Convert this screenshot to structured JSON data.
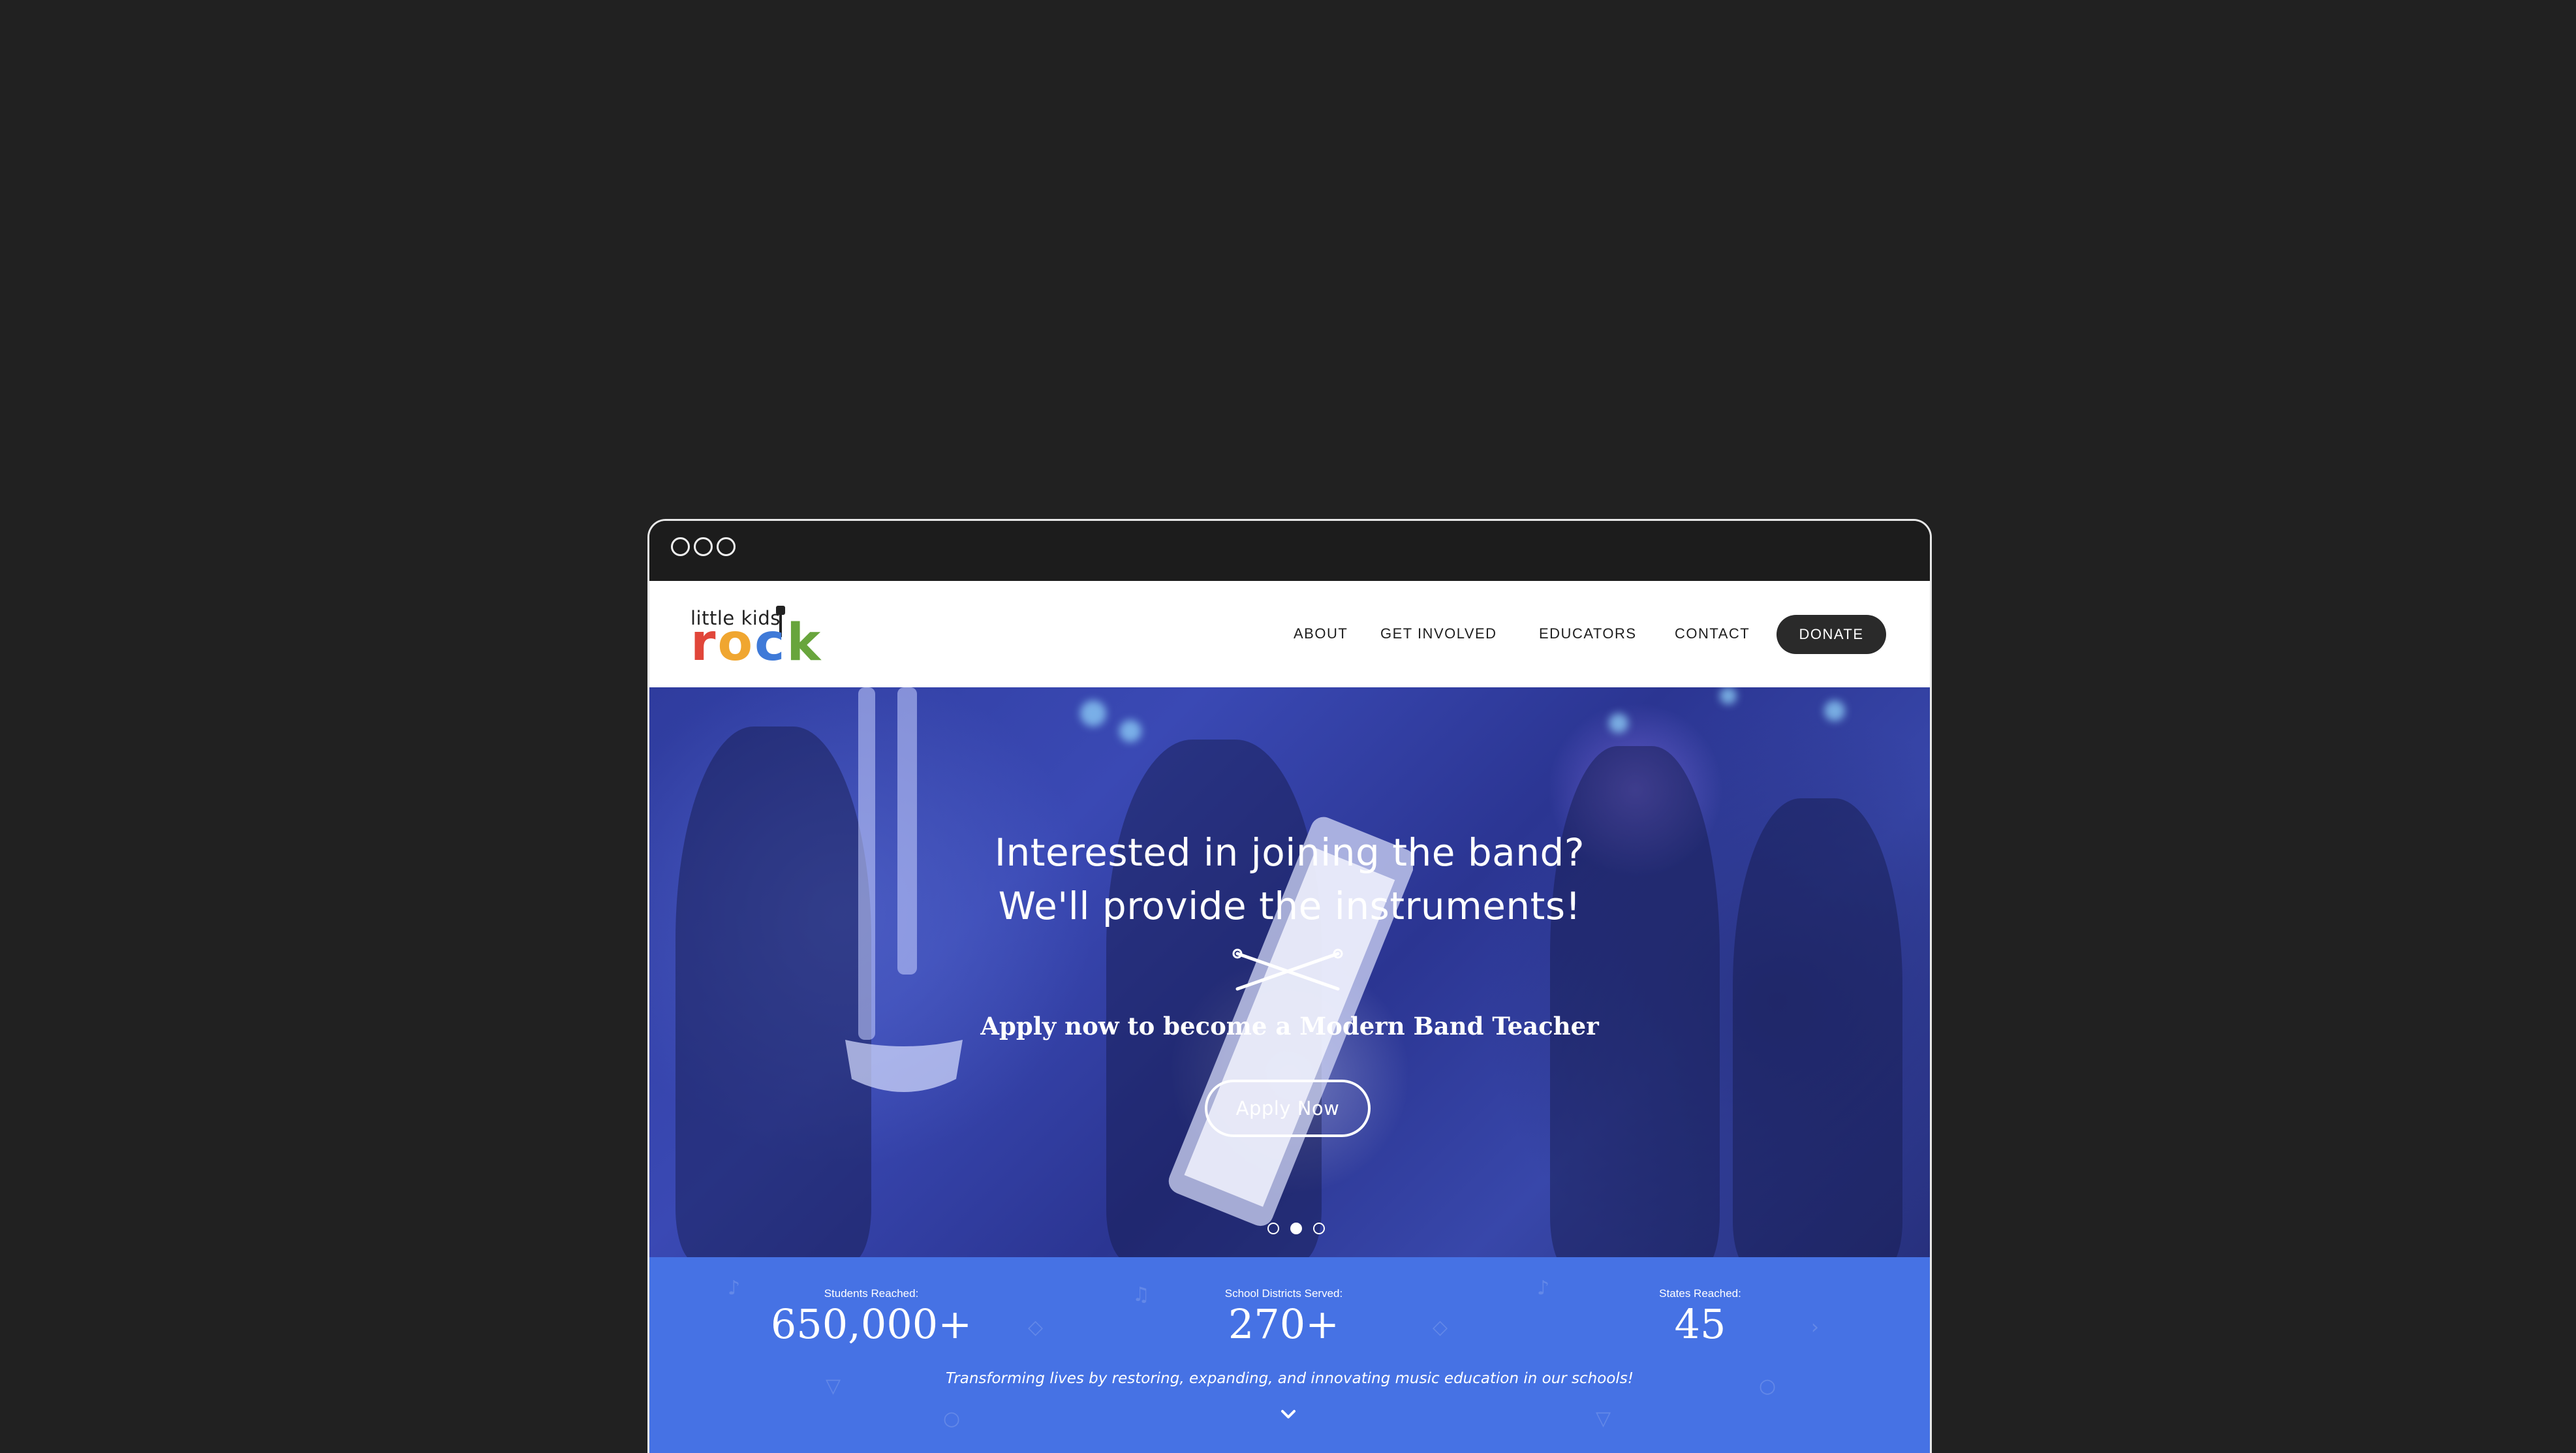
{
  "header": {
    "logo_top": "little kids",
    "logo_bottom_letters": [
      "r",
      "o",
      "c",
      "k"
    ],
    "nav": {
      "about": "ABOUT",
      "get_involved": "GET INVOLVED",
      "educators": "EDUCATORS",
      "contact": "CONTACT",
      "donate": "DONATE"
    }
  },
  "hero": {
    "title_line1": "Interested in joining the band?",
    "title_line2": "We'll provide the instruments!",
    "subtitle": "Apply now to become a Modern Band Teacher",
    "cta": "Apply  Now",
    "carousel": {
      "slides": 3,
      "active": 2
    }
  },
  "stats": {
    "items": [
      {
        "label": "Students Reached:",
        "value": "650,000+"
      },
      {
        "label": "School Districts Served:",
        "value": "270+"
      },
      {
        "label": "States Reached:",
        "value": "45"
      }
    ],
    "tagline": "Transforming lives by restoring, expanding, and innovating music education in our schools!"
  },
  "colors": {
    "page_background": "#212121",
    "stats_background": "#4672e4",
    "donate_button": "#2a2a2a",
    "logo_r": "#e1463a",
    "logo_o": "#f0a630",
    "logo_c": "#3f7ad8",
    "logo_k": "#68a53c"
  },
  "icons": [
    "window-control-icon",
    "guitar-icon",
    "drumsticks-icon",
    "chevron-down-icon"
  ]
}
